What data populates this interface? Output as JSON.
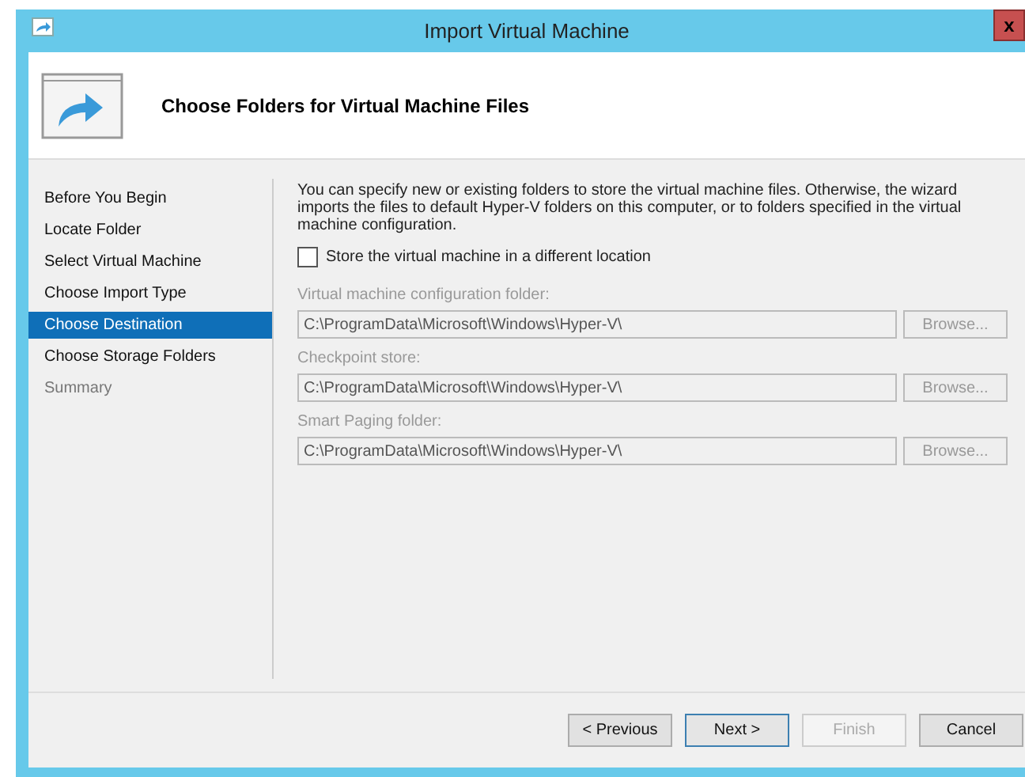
{
  "window": {
    "title": "Import Virtual Machine",
    "close": "x"
  },
  "header": {
    "title": "Choose Folders for Virtual Machine Files"
  },
  "steps": [
    {
      "label": "Before You Begin",
      "selected": false,
      "disabled": false
    },
    {
      "label": "Locate Folder",
      "selected": false,
      "disabled": false
    },
    {
      "label": "Select Virtual Machine",
      "selected": false,
      "disabled": false
    },
    {
      "label": "Choose Import Type",
      "selected": false,
      "disabled": false
    },
    {
      "label": "Choose Destination",
      "selected": true,
      "disabled": false
    },
    {
      "label": "Choose Storage Folders",
      "selected": false,
      "disabled": false
    },
    {
      "label": "Summary",
      "selected": false,
      "disabled": true
    }
  ],
  "description": "You can specify new or existing folders to store the virtual machine files. Otherwise, the wizard imports the files to default Hyper-V folders on this computer, or to folders specified in the virtual machine configuration.",
  "store_checkbox": {
    "label": "Store the virtual machine in a different location",
    "checked": false
  },
  "folders": [
    {
      "label": "Virtual machine configuration folder:",
      "value": "C:\\ProgramData\\Microsoft\\Windows\\Hyper-V\\",
      "button": "Browse...",
      "disabled": true
    },
    {
      "label": "Checkpoint store:",
      "value": "C:\\ProgramData\\Microsoft\\Windows\\Hyper-V\\",
      "button": "Browse...",
      "disabled": true
    },
    {
      "label": "Smart Paging folder:",
      "value": "C:\\ProgramData\\Microsoft\\Windows\\Hyper-V\\",
      "button": "Browse...",
      "disabled": true
    }
  ],
  "buttons": [
    {
      "label": "< Previous",
      "default": false,
      "disabled": false
    },
    {
      "label": "Next >",
      "default": true,
      "disabled": false
    },
    {
      "label": "Finish",
      "default": false,
      "disabled": true
    },
    {
      "label": "Cancel",
      "default": false,
      "disabled": false
    }
  ]
}
